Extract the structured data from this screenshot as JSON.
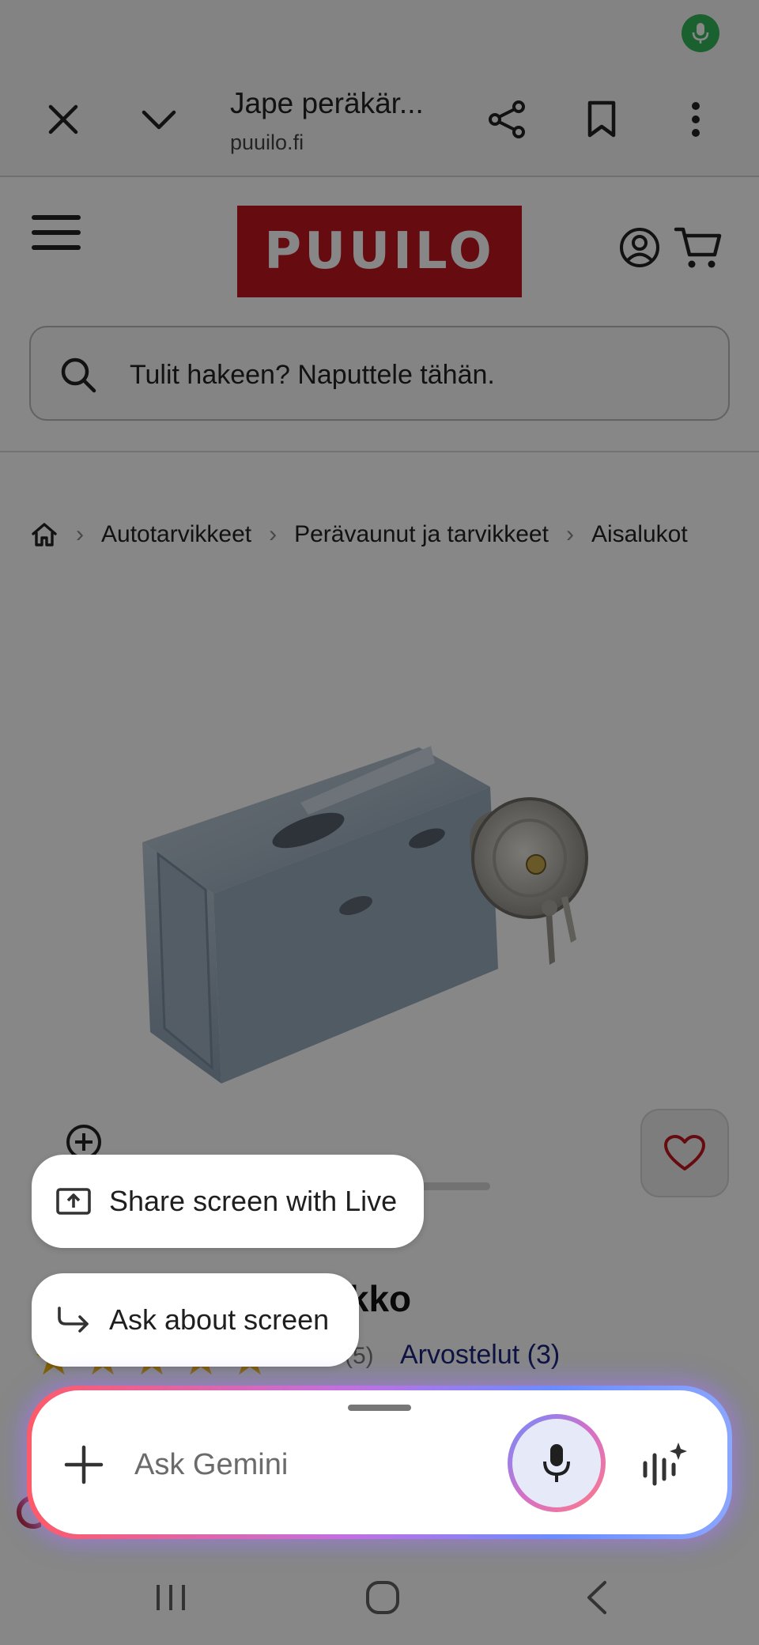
{
  "browser": {
    "page_title": "Jape peräkär...",
    "domain": "puuilo.fi"
  },
  "site": {
    "logo_text": "PUUILO",
    "search_placeholder": "Tulit hakeen? Naputtele tähän.",
    "brand_color": "#c0181f"
  },
  "breadcrumb": {
    "items": [
      "Autotarvikkeet",
      "Perävaunut ja tarvikkeet",
      "Aisalukot"
    ]
  },
  "product": {
    "title_partial": "lukko",
    "review_count": "(5)",
    "reviews_link": "Arvostelut (3)"
  },
  "popups": {
    "share_label": "Share screen with Live",
    "ask_label": "Ask about screen"
  },
  "gemini": {
    "input_placeholder": "Ask Gemini"
  },
  "icons": {
    "status": "mic-icon",
    "close": "close-icon",
    "minimize": "chevron-down-icon",
    "share": "share-icon",
    "bookmark": "bookmark-icon",
    "more": "more-vert-icon",
    "menu": "hamburger-menu-icon",
    "account": "account-icon",
    "cart": "cart-icon",
    "search": "search-icon",
    "home": "home-icon",
    "zoom": "zoom-in-icon",
    "favorite": "heart-icon",
    "add": "plus-icon",
    "live": "gemini-live-icon",
    "nav_recents": "recents-icon",
    "nav_home": "home-circle-icon",
    "nav_back": "back-icon"
  }
}
